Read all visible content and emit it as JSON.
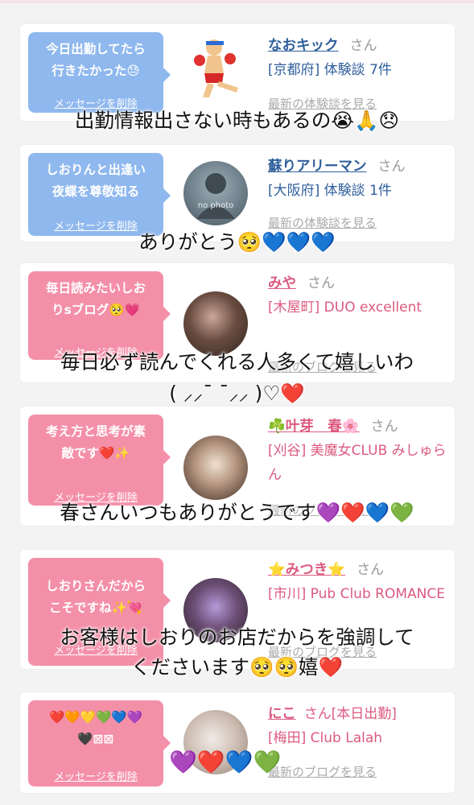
{
  "cards": [
    {
      "message": "今日出勤してたら\n行きたかった😓",
      "delete_label": "メッセージを削除",
      "name": "なおキック",
      "honorific": "さん",
      "meta": "[京都府] 体験談 7件",
      "link": "最新の体験談を見る",
      "avatar_text": "",
      "color": "#8fb8ee"
    },
    {
      "message": "しおりんと出逢い\n夜蝶を尊敬知る",
      "delete_label": "メッセージを削除",
      "name": "蘇りアリーマン",
      "honorific": "さん",
      "meta": "[大阪府] 体験談 1件",
      "link": "最新の体験談を見る",
      "avatar_text": "no photo",
      "color": "#8fb8ee"
    },
    {
      "message": "毎日読みたいしお\nりsブログ🥺💗",
      "delete_label": "メッセージを削除",
      "name": "みや",
      "honorific": "さん",
      "meta": "[木屋町] DUO excellent",
      "link": "最新のブログを見る",
      "avatar_text": "",
      "color": "#f48fa8"
    },
    {
      "message": "考え方と思考が素\n敵です❤️✨",
      "delete_label": "メッセージを削除",
      "name": "☘️叶芽　春🌸",
      "honorific": "さん",
      "meta": "[刈谷] 美魔女CLUB みしゅらん",
      "link": "最新のブログを見る",
      "avatar_text": "",
      "color": "#f48fa8"
    },
    {
      "message": "しおりさんだから\nこそですね✨💘",
      "delete_label": "メッセージを削除",
      "name": "⭐️みつき⭐️",
      "honorific": "さん",
      "meta": "[市川] Pub Club ROMANCE",
      "link": "最新のブログを見る",
      "avatar_text": "",
      "color": "#f48fa8"
    },
    {
      "message": "❤️🧡💛💚💙💜\n🖤⊠⊠",
      "delete_label": "メッセージを削除",
      "name": "にこ",
      "honorific": "さん[本日出勤]",
      "meta": "[梅田] Club Lalah",
      "link": "最新のブログを見る",
      "avatar_text": "",
      "color": "#f48fa8"
    }
  ],
  "captions": {
    "c1": "出勤情報出さない時もあるの😭🙏😞",
    "c2": "ありがとう🥺💙💙💙",
    "c3_line1": "毎日必ず読んでくれる人多くて嬉しいわ",
    "c3_line2": "( ⸝⸝¯ ¯⸝⸝ )♡❤️",
    "c4": "春さんいつもありがとうです💜❤️💙💚",
    "c5_line1": "お客様はしおりのお店だからを強調して",
    "c5_line2": "くださいます🥺🥺嬉❤️",
    "c6": "💜❤️💙💚"
  }
}
